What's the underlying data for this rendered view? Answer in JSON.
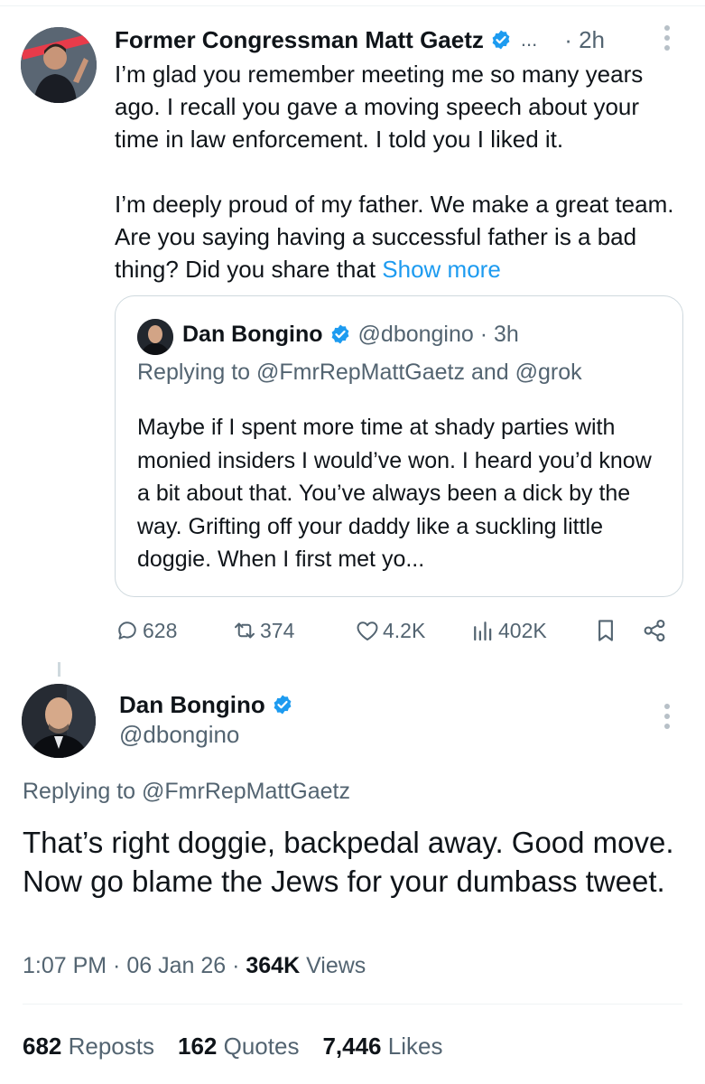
{
  "parent": {
    "author_name": "Former Congressman Matt Gaetz",
    "truncation": "...",
    "time": "· 2h",
    "paragraphs": [
      "I’m glad you remember meeting me so many years ago.  I recall you gave a moving speech about your time in law enforcement. I told you I liked it.",
      "I’m deeply proud of my father.  We make a great team.  Are you saying having a successful father is a bad thing? Did you share that "
    ],
    "show_more": "Show more"
  },
  "quote": {
    "author_name": "Dan Bongino",
    "handle_time": "@dbongino · 3h",
    "replying_to": "Replying to @FmrRepMattGaetz and @grok",
    "text": "Maybe if I spent more time at shady parties with monied insiders I would’ve won. I heard you’d know a bit about that. You’ve always been a dick by the way. Grifting off your daddy like a suckling little doggie. When I first met yo..."
  },
  "actions": {
    "replies": "628",
    "reposts": "374",
    "likes": "4.2K",
    "views": "402K"
  },
  "main": {
    "author_name": "Dan Bongino",
    "handle": "@dbongino",
    "replying_to": "Replying to @FmrRepMattGaetz",
    "lines": [
      "That’s right doggie, backpedal away. Good move.",
      "Now go blame the Jews for your dumbass tweet."
    ],
    "time_date": "1:07 PM · 06 Jan 26 · ",
    "views_count": "364K",
    "views_label": " Views",
    "stats": {
      "reposts_count": "682",
      "reposts_label": " Reposts",
      "quotes_count": "162",
      "quotes_label": " Quotes",
      "likes_count": "7,446",
      "likes_label": " Likes"
    }
  },
  "colors": {
    "accent": "#1d9bf0",
    "muted": "#536471",
    "text": "#0f1419",
    "border": "#cfd9de"
  }
}
